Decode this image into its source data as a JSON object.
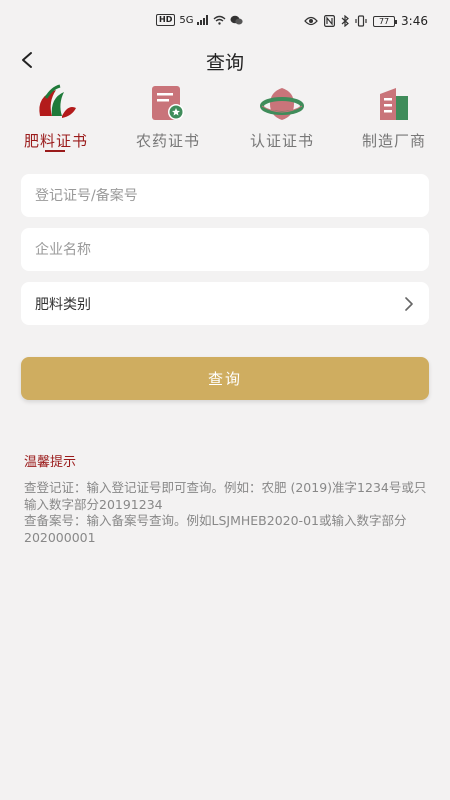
{
  "status_bar": {
    "hd": "HD",
    "signal": "5G",
    "time": "3:46",
    "battery": "77"
  },
  "nav": {
    "title": "查询"
  },
  "tabs": [
    {
      "label": "肥料证书",
      "icon": "fertilizer-leaf-icon",
      "active": true
    },
    {
      "label": "农药证书",
      "icon": "certificate-badge-icon",
      "active": false
    },
    {
      "label": "认证证书",
      "icon": "certification-ring-icon",
      "active": false
    },
    {
      "label": "制造厂商",
      "icon": "factory-building-icon",
      "active": false
    }
  ],
  "form": {
    "registration_placeholder": "登记证号/备案号",
    "company_placeholder": "企业名称",
    "category_label": "肥料类别"
  },
  "query_button": "查询",
  "tips": {
    "title": "温馨提示",
    "line1": "查登记证：输入登记证号即可查询。例如：农肥 (2019)准字1234号或只输入数字部分20191234",
    "line2": "查备案号：输入备案号查询。例如LSJMHEB2020-01或输入数字部分202000001"
  },
  "colors": {
    "accent": "#9a1b1b",
    "button": "#cfad60",
    "background": "#f3f2f2"
  }
}
